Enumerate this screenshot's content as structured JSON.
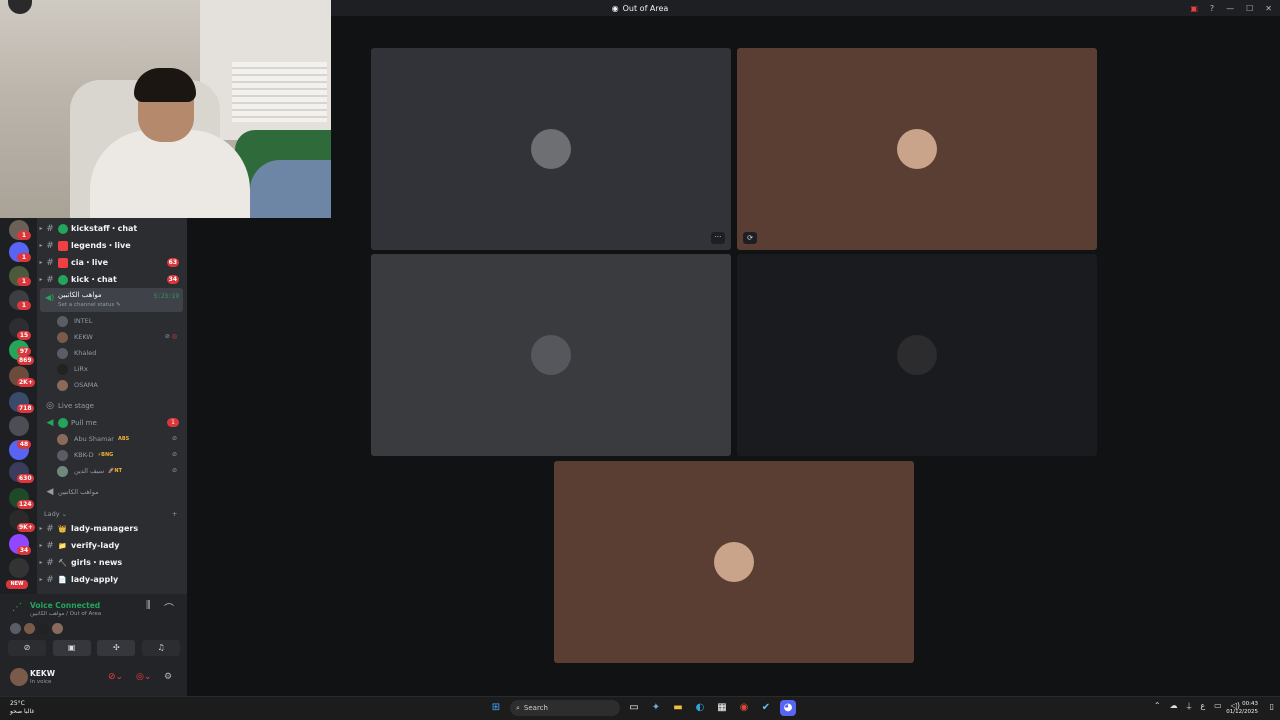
{
  "window": {
    "title": "Out of Area",
    "help": "?",
    "minimize": "—",
    "maximize": "☐",
    "close": "✕"
  },
  "rail": {
    "badges": [
      "1",
      "1",
      "1",
      "1",
      "15",
      "97",
      "869",
      "2K+",
      "718",
      "48",
      "630",
      "124",
      "9K+",
      "34"
    ],
    "new_label": "NEW"
  },
  "channels": [
    {
      "name": "kickstaff・chat",
      "emoji_color": "#23a55a"
    },
    {
      "name": "legends・live",
      "emoji_color": "#f23f43"
    },
    {
      "name": "cia・live",
      "emoji_color": "#f23f43",
      "count": "63"
    },
    {
      "name": "kick・chat",
      "emoji_color": "#23a55a",
      "count": "34"
    }
  ],
  "voice_channel": {
    "name": "مواهب الكاتبين",
    "status": "Set a channel status ✎",
    "timer": "5:23:19",
    "users": [
      "INTEL",
      "KEKW",
      "Khaled",
      "LiRx",
      "OSAMA"
    ]
  },
  "live_stage": {
    "label": "Live stage"
  },
  "pull_me": {
    "label": "Pull me",
    "count": "1",
    "users": [
      {
        "name": "Abu Shamar",
        "tag": "ABS"
      },
      {
        "name": "KBK-D",
        "tag": "⚡BNG"
      },
      {
        "name": "سيف الدين",
        "tag": "🚀NT"
      }
    ]
  },
  "extra_voice": "مواهب الكاتبين",
  "category": {
    "name": "Lady ⌄",
    "plus": "+"
  },
  "lady_channels": [
    {
      "name": "lady-managers",
      "emoji": "👑"
    },
    {
      "name": "verify-lady",
      "emoji": "📁"
    },
    {
      "name": "girls・news",
      "emoji": "🔨"
    },
    {
      "name": "lady-apply",
      "emoji": "📄"
    }
  ],
  "voice_panel": {
    "status": "Voice Connected",
    "where": "مواهب الكاتبين / Out of Area"
  },
  "user": {
    "name": "KEKW",
    "status": "In voice"
  },
  "tiles": [
    {
      "bg": "#313338",
      "avatar": "#6e6f73",
      "more": "···"
    },
    {
      "bg": "#5a3e34",
      "avatar": "#c9a48b",
      "swap": "⟳"
    },
    {
      "bg": "#3a3b3f",
      "avatar": "#55575c"
    },
    {
      "bg": "#1a1b1e",
      "avatar": "#2c2c2f"
    },
    {
      "bg": "#5a3e34",
      "avatar": "#c9a48b"
    }
  ],
  "taskbar": {
    "temp": "25°C",
    "weather_text": "غالبا صحو",
    "search": "Search",
    "time": "00:43",
    "date": "01/12/2025",
    "lang": "ع"
  }
}
